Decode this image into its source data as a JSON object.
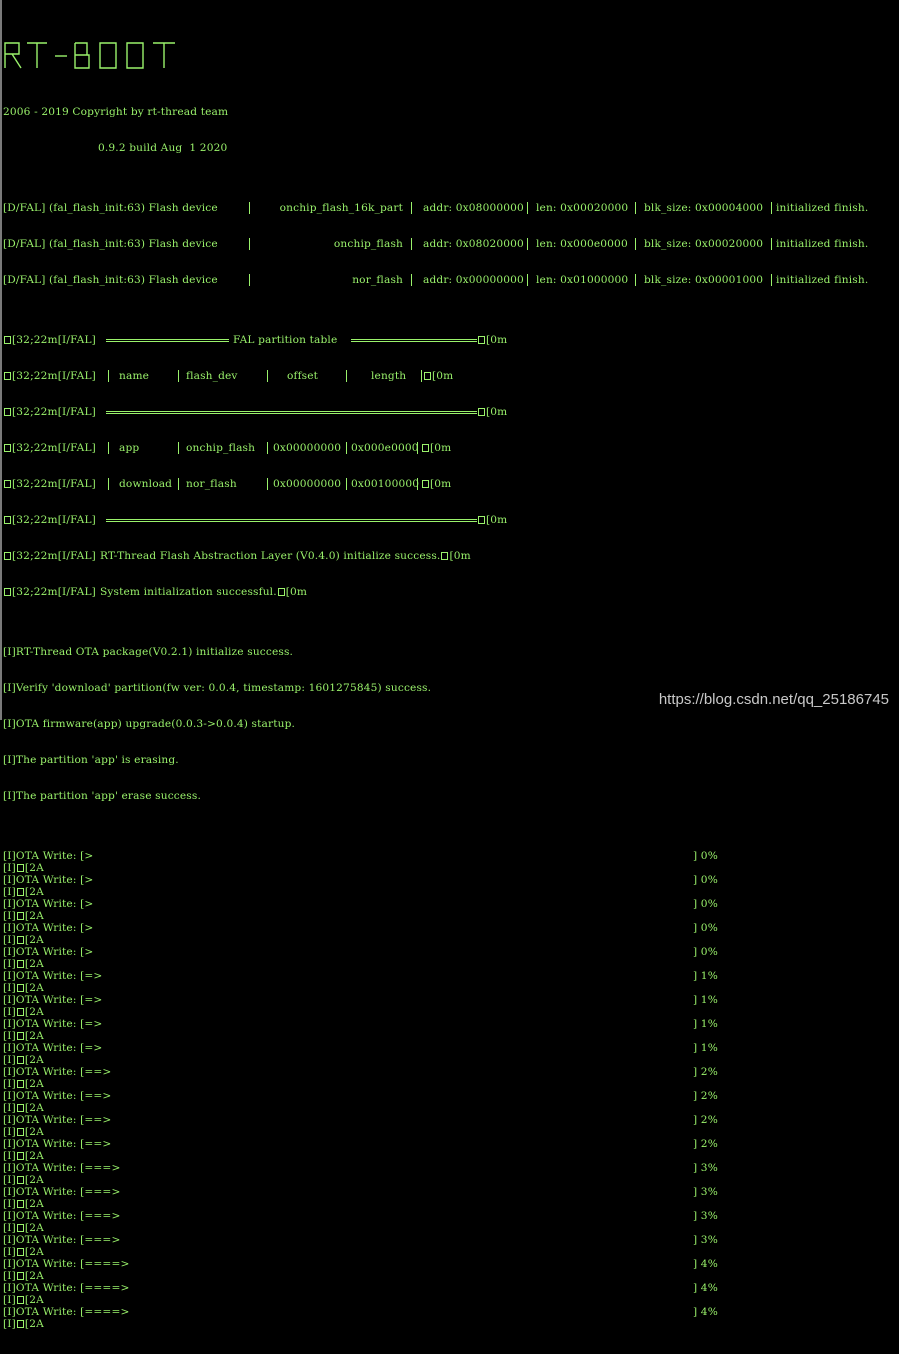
{
  "banner": "RT-BOOT",
  "copyright": "2006 - 2019 Copyright by rt-thread team",
  "build": "0.9.2 build Aug  1 2020",
  "flash_devices": [
    {
      "prefix": "[D/FAL] (fal_flash_init:63) Flash device",
      "name": "onchip_flash_16k_part",
      "addr": "addr: 0x08000000",
      "len": "len: 0x00020000",
      "blk": "blk_size: 0x00004000",
      "status": "initialized finish."
    },
    {
      "prefix": "[D/FAL] (fal_flash_init:63) Flash device",
      "name": "onchip_flash",
      "addr": "addr: 0x08020000",
      "len": "len: 0x000e0000",
      "blk": "blk_size: 0x00020000",
      "status": "initialized finish."
    },
    {
      "prefix": "[D/FAL] (fal_flash_init:63) Flash device",
      "name": "nor_flash",
      "addr": "addr: 0x00000000",
      "len": "len: 0x01000000",
      "blk": "blk_size: 0x00001000",
      "status": "initialized finish."
    }
  ],
  "fal_prefix": "[32;22m[I/FAL]",
  "fal_title": "FAL partition table",
  "fal_reset": "[0m",
  "fal_headers": {
    "name": "name",
    "flash_dev": "flash_dev",
    "offset": "offset",
    "length": "length"
  },
  "fal_rows": [
    {
      "name": "app",
      "flash_dev": "onchip_flash",
      "offset": "0x00000000",
      "length": "0x000e0000"
    },
    {
      "name": "download",
      "flash_dev": "nor_flash",
      "offset": "0x00000000",
      "length": "0x00100000"
    }
  ],
  "fal_init": "RT-Thread Flash Abstraction Layer (V0.4.0) initialize success.",
  "sys_init": "System initialization successful.",
  "ota_lines": [
    "[I]RT-Thread OTA package(V0.2.1) initialize success.",
    "[I]Verify 'download' partition(fw ver: 0.0.4, timestamp: 1601275845) success.",
    "[I]OTA firmware(app) upgrade(0.0.3->0.0.4) startup.",
    "[I]The partition 'app' is erasing.",
    "[I]The partition 'app' erase success."
  ],
  "ota_prefix": "[I]",
  "ota_write_label": "OTA Write: [",
  "clear_seq": "[2A",
  "progress": [
    {
      "bar": ">",
      "pct": "] 0%"
    },
    {
      "bar": ">",
      "pct": "] 0%"
    },
    {
      "bar": ">",
      "pct": "] 0%"
    },
    {
      "bar": ">",
      "pct": "] 0%"
    },
    {
      "bar": ">",
      "pct": "] 0%"
    },
    {
      "bar": "=>",
      "pct": "] 1%"
    },
    {
      "bar": "=>",
      "pct": "] 1%"
    },
    {
      "bar": "=>",
      "pct": "] 1%"
    },
    {
      "bar": "=>",
      "pct": "] 1%"
    },
    {
      "bar": "==>",
      "pct": "] 2%"
    },
    {
      "bar": "==>",
      "pct": "] 2%"
    },
    {
      "bar": "==>",
      "pct": "] 2%"
    },
    {
      "bar": "==>",
      "pct": "] 2%"
    },
    {
      "bar": "===>",
      "pct": "] 3%"
    },
    {
      "bar": "===>",
      "pct": "] 3%"
    },
    {
      "bar": "===>",
      "pct": "] 3%"
    },
    {
      "bar": "===>",
      "pct": "] 3%"
    },
    {
      "bar": "====>",
      "pct": "] 4%"
    },
    {
      "bar": "====>",
      "pct": "] 4%"
    },
    {
      "bar": "====>",
      "pct": "] 4%"
    }
  ],
  "watermark": "https://blog.csdn.net/qq_25186745",
  "colors": {
    "text": "#9af26b",
    "background": "#000000"
  }
}
